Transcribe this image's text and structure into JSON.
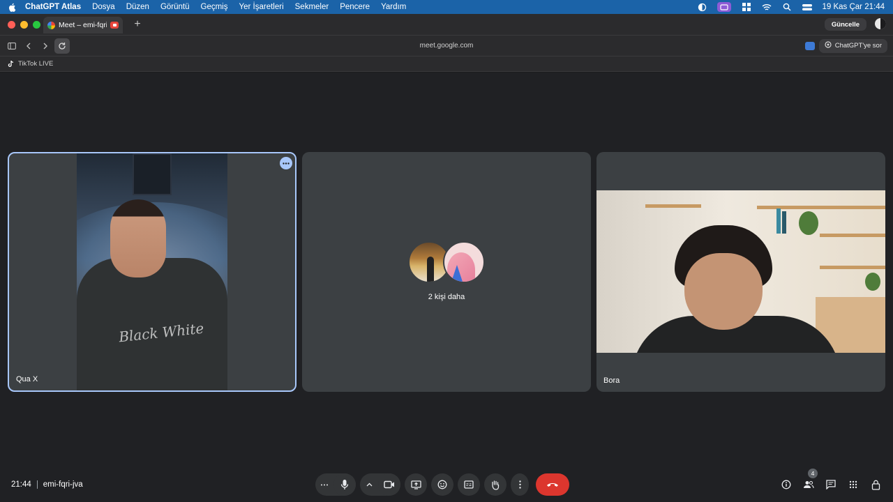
{
  "menubar": {
    "app_name": "ChatGPT Atlas",
    "menus": [
      "Dosya",
      "Düzen",
      "Görüntü",
      "Geçmiş",
      "Yer İşaretleri",
      "Sekmeler",
      "Pencere",
      "Yardım"
    ],
    "clock": "19 Kas Çar  21:44"
  },
  "browser": {
    "tab_title": "Meet – emi-fqri-jva",
    "update_label": "Güncelle",
    "url": "meet.google.com",
    "ask_label": "ChatGPT'ye sor",
    "bookmark": "TikTok LIVE"
  },
  "meet": {
    "tiles": [
      {
        "name": "Qua X"
      },
      {
        "name": "",
        "more_label": "2 kişi daha"
      },
      {
        "name": "Bora"
      }
    ],
    "time": "21:44",
    "meeting_code": "emi-fqri-jva",
    "people_count": "4",
    "shirt_print": "Black White",
    "accent": "#a8c7fa",
    "hangup_color": "#dc362e"
  },
  "icons": [
    "apple-icon",
    "record-icon",
    "mic-icon",
    "camera-icon",
    "present-icon",
    "emoji-icon",
    "captions-icon",
    "raise-hand-icon",
    "more-vert-icon",
    "hangup-icon",
    "info-icon",
    "people-icon",
    "chat-icon",
    "activities-icon",
    "lock-icon"
  ]
}
